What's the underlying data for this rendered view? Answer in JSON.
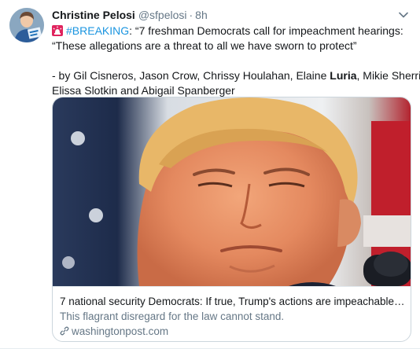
{
  "tweet": {
    "author_name": "Christine Pelosi",
    "author_handle": "@sfpelosi",
    "separator": "·",
    "time": "8h",
    "avatar_icon": "profile-photo",
    "alert_emoji_icon": "rotating-light-icon",
    "hashtag": "#BREAKING",
    "line1_rest": ": “7 freshman Democrats call for impeachment hearings:",
    "line2": "“These allegations are a threat to all we have sworn to protect”",
    "line3": "- by Gil Cisneros, Jason Crow, Chrissy Houlahan, Elaine",
    "line3_bold": "Luria",
    "line3_end": ", Mikie Sherrill,",
    "line4": "Elissa Slotkin and Abigail Spanberger"
  },
  "card": {
    "title": "7 national security Democrats: If true, Trump's actions are impeachable ...",
    "description": "This flagrant disregard for the law cannot stand.",
    "domain": "washingtonpost.com",
    "domain_icon": "link-icon"
  },
  "colors": {
    "link": "#1b95e0",
    "secondary_text": "#657786",
    "border": "#ccd6dd"
  }
}
